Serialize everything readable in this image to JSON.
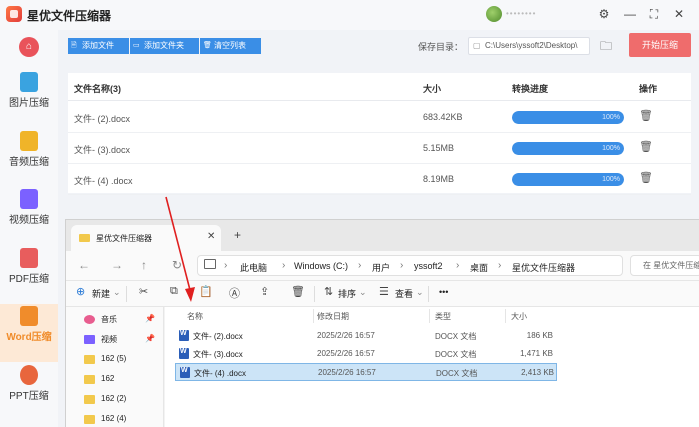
{
  "app": {
    "title": "星优文件压缩器",
    "user_name": "••••••••"
  },
  "window_controls": {
    "settings": "⚙",
    "menu": "☰",
    "minimize": "—",
    "maximize": "⛶",
    "close": "✕"
  },
  "sidebar": {
    "home_icon": "home-icon",
    "items": [
      {
        "label": "图片压缩",
        "color": "#3aa3e0"
      },
      {
        "label": "音频压缩",
        "color": "#f0b429"
      },
      {
        "label": "视频压缩",
        "color": "#7b61ff"
      },
      {
        "label": "PDF压缩",
        "color": "#e85d5d"
      },
      {
        "label": "Word压缩",
        "color": "#f08c2b",
        "active": true
      },
      {
        "label": "PPT压缩",
        "color": "#e8663d"
      }
    ]
  },
  "toolbar": {
    "add_file": "添加文件",
    "add_folder": "添加文件夹",
    "clear_list": "清空列表",
    "save_dir_label": "保存目录：",
    "save_dir_value": "C:\\Users\\yssoft2\\Desktop\\",
    "start_button": "开始压缩"
  },
  "table": {
    "headers": {
      "name": "文件名称(3)",
      "size": "大小",
      "progress": "转换进度",
      "action": "操作"
    },
    "rows": [
      {
        "name": "文件- (2).docx",
        "size": "683.42KB",
        "progress_pct": 100,
        "progress_label": "100%"
      },
      {
        "name": "文件- (3).docx",
        "size": "5.15MB",
        "progress_pct": 100,
        "progress_label": "100%"
      },
      {
        "name": "文件- (4) .docx",
        "size": "8.19MB",
        "progress_pct": 100,
        "progress_label": "100%"
      }
    ]
  },
  "explorer": {
    "tab_title": "星优文件压缩器",
    "new_tab": "+",
    "breadcrumb": [
      "此电脑",
      "Windows (C:)",
      "用户",
      "yssoft2",
      "桌面",
      "星优文件压缩器"
    ],
    "search_placeholder": "在 星优文件压缩器",
    "commands": {
      "new": "新建",
      "sort": "排序",
      "view": "查看",
      "more": "•••"
    },
    "nav_items": [
      {
        "label": "音乐",
        "icon_color": "#e85d8f",
        "pinned": true
      },
      {
        "label": "视频",
        "icon_color": "#7b61ff",
        "pinned": true
      },
      {
        "label": "162 (5)",
        "icon_color": "#f2c94c"
      },
      {
        "label": "162",
        "icon_color": "#f2c94c"
      },
      {
        "label": "162 (2)",
        "icon_color": "#f2c94c"
      },
      {
        "label": "162 (4)",
        "icon_color": "#f2c94c"
      }
    ],
    "columns": {
      "name": "名称",
      "modified": "修改日期",
      "type": "类型",
      "size": "大小"
    },
    "files": [
      {
        "name": "文件- (2).docx",
        "modified": "2025/2/26 16:57",
        "type": "DOCX 文档",
        "size": "186 KB"
      },
      {
        "name": "文件- (3).docx",
        "modified": "2025/2/26 16:57",
        "type": "DOCX 文档",
        "size": "1,471 KB"
      },
      {
        "name": "文件- (4) .docx",
        "modified": "2025/2/26 16:57",
        "type": "DOCX 文档",
        "size": "2,413 KB",
        "selected": true
      }
    ]
  }
}
